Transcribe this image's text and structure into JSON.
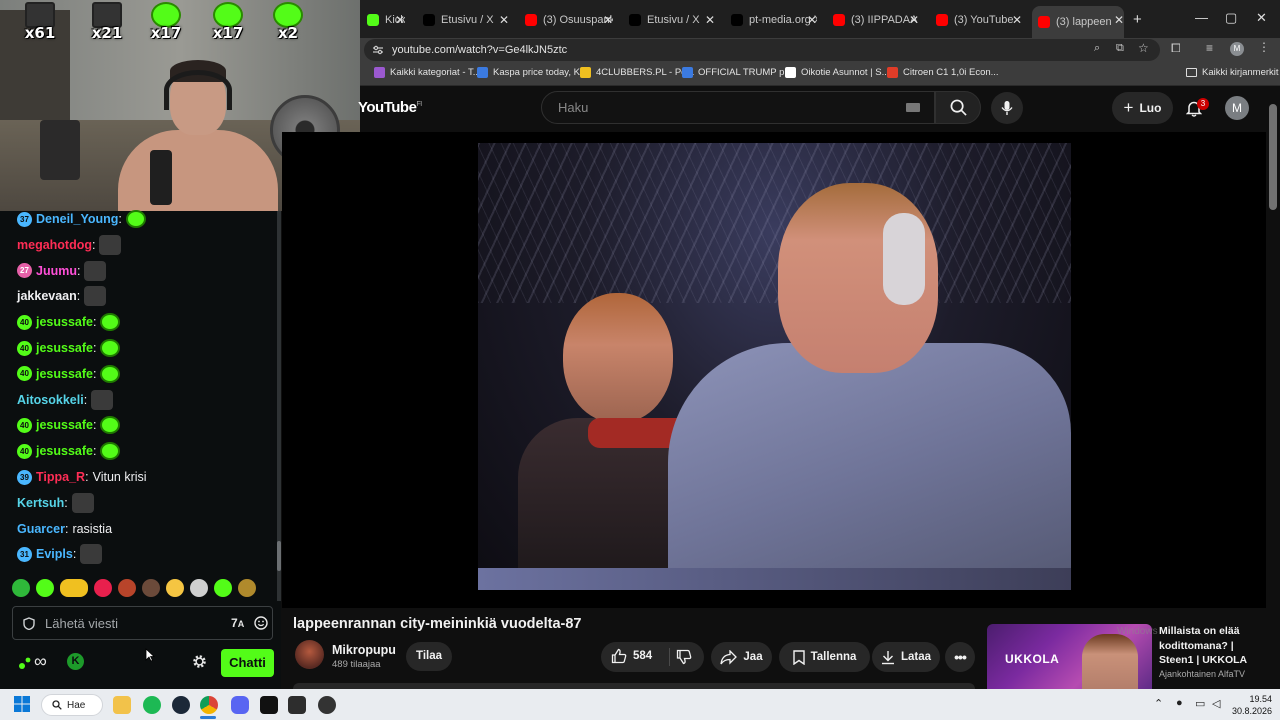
{
  "webcam": {
    "emotes": [
      {
        "count": "x61",
        "kind": "photo"
      },
      {
        "count": "x21",
        "kind": "photo"
      },
      {
        "count": "x17",
        "kind": "green"
      },
      {
        "count": "x17",
        "kind": "green"
      },
      {
        "count": "x2",
        "kind": "green"
      }
    ]
  },
  "chat": {
    "messages": [
      {
        "badge": "37",
        "user": "Deneil_Young",
        "user_color": "#4ab7ff",
        "text": "",
        "emote": "green"
      },
      {
        "badge": "",
        "user": "megahotdog",
        "user_color": "#ff2d55",
        "text": "",
        "emote": "photo"
      },
      {
        "badge": "27",
        "user": "Juumu",
        "user_color": "#ff4fd8",
        "text": "",
        "emote": "photo"
      },
      {
        "badge": "",
        "user": "jakkevaan",
        "user_color": "#efeff1",
        "text": "",
        "emote": "photo"
      },
      {
        "badge": "40",
        "user": "jesussafe",
        "user_color": "#53fc18",
        "text": "",
        "emote": "green"
      },
      {
        "badge": "40",
        "user": "jesussafe",
        "user_color": "#53fc18",
        "text": "",
        "emote": "green"
      },
      {
        "badge": "40",
        "user": "jesussafe",
        "user_color": "#53fc18",
        "text": "",
        "emote": "green"
      },
      {
        "badge": "",
        "user": "Aitosokkeli",
        "user_color": "#56d4e8",
        "text": "",
        "emote": "photo"
      },
      {
        "badge": "40",
        "user": "jesussafe",
        "user_color": "#53fc18",
        "text": "",
        "emote": "green"
      },
      {
        "badge": "40",
        "user": "jesussafe",
        "user_color": "#53fc18",
        "text": "",
        "emote": "green"
      },
      {
        "badge": "39",
        "user": "Tippa_R",
        "user_color": "#ff2d55",
        "text": "Vitun krisi",
        "emote": ""
      },
      {
        "badge": "",
        "user": "Kertsuh",
        "user_color": "#56d4e8",
        "text": "",
        "emote": "photo"
      },
      {
        "badge": "",
        "user": "Guarcer",
        "user_color": "#4ab7ff",
        "text": "rasistia",
        "emote": ""
      },
      {
        "badge": "31",
        "user": "Evipls",
        "user_color": "#4ab7ff",
        "text": "",
        "emote": "photo"
      }
    ],
    "input_placeholder": "Lähetä viesti",
    "send_label": "Chatti",
    "infinity_label": "∞",
    "accent": "#53fc18"
  },
  "browser": {
    "tabs": [
      {
        "label": "Kick D",
        "icon_color": "#53fc18"
      },
      {
        "label": "Etusivu / X",
        "icon_color": "#000000"
      },
      {
        "label": "(3) Osuuspanki",
        "icon_color": "#ff0000"
      },
      {
        "label": "Etusivu / X",
        "icon_color": "#000000"
      },
      {
        "label": "pt-media.org X",
        "icon_color": "#000000"
      },
      {
        "label": "(3) IIPPADAA h",
        "icon_color": "#ff0000"
      },
      {
        "label": "(3) YouTube",
        "icon_color": "#ff0000"
      },
      {
        "label": "(3) lappeen",
        "icon_color": "#ff0000"
      }
    ],
    "url": "youtube.com/watch?v=Ge4lkJN5ztc",
    "bookmarks": [
      {
        "label": "Kaikki kategoriat - T...",
        "icon_color": "#9b59d0"
      },
      {
        "label": "Kaspa price today, K...",
        "icon_color": "#3b7ae0"
      },
      {
        "label": "4CLUBBERS.PL - Po...",
        "icon_color": "#f0c020"
      },
      {
        "label": "OFFICIAL TRUMP pr...",
        "icon_color": "#3b7ae0"
      },
      {
        "label": "Oikotie Asunnot | S...",
        "icon_color": "#ffffff"
      },
      {
        "label": "Citroen C1 1,0i Econ...",
        "icon_color": "#e03c28"
      }
    ],
    "all_bookmarks_label": "Kaikki kirjanmerkit"
  },
  "youtube": {
    "logo": "YouTube",
    "region": "FI",
    "search_placeholder": "Haku",
    "create_label": "Luo",
    "notifications": "3",
    "avatar_letter": "M",
    "video_title": "lappeenrannan city-meininkiä vuodelta-87",
    "channel_name": "Mikropupu",
    "channel_subs": "489 tilaajaa",
    "subscribe_label": "Tilaa",
    "like_count": "584",
    "share_label": "Jaa",
    "save_label": "Tallenna",
    "download_label": "Lataa",
    "ad": {
      "brand": "UKKOLA",
      "title": "Millaista on elää kodittomana? | Steen1 | UKKOLA",
      "channel": "Ajankohtainen AlfaTV",
      "ghost_text": "Windows"
    }
  },
  "taskbar": {
    "search_label": "Hae",
    "time": "19.54",
    "date": "30.8.2026"
  }
}
